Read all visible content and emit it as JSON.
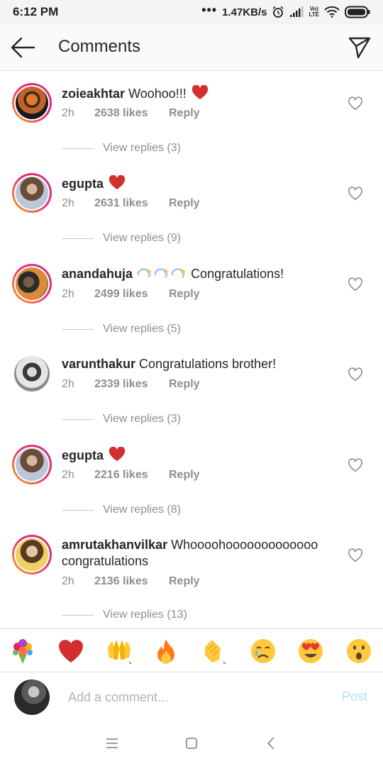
{
  "status_bar": {
    "time": "6:12 PM",
    "network_speed": "1.47KB/s",
    "volte_top": "Vo)",
    "volte_bottom": "LTE"
  },
  "header": {
    "title": "Comments",
    "back_icon": "arrow-left-icon",
    "share_icon": "paper-plane-icon"
  },
  "comments": [
    {
      "user": "zoieakhtar",
      "text": "Woohoo!!!",
      "emoji": "red-heart",
      "time": "2h",
      "likes": "2638 likes",
      "reply": "Reply",
      "view_replies": "View replies (3)"
    },
    {
      "user": "egupta",
      "text": "",
      "emoji": "red-heart",
      "time": "2h",
      "likes": "2631 likes",
      "reply": "Reply",
      "view_replies": "View replies (9)"
    },
    {
      "user": "anandahuja",
      "text": "Congratulations!",
      "emoji": "dizzy-sparkles-x3",
      "time": "2h",
      "likes": "2499 likes",
      "reply": "Reply",
      "view_replies": "View replies (5)"
    },
    {
      "user": "varunthakur",
      "text": "Congratulations brother!",
      "emoji": "",
      "time": "2h",
      "likes": "2339 likes",
      "reply": "Reply",
      "view_replies": "View replies (3)"
    },
    {
      "user": "egupta",
      "text": "",
      "emoji": "red-heart",
      "time": "2h",
      "likes": "2216 likes",
      "reply": "Reply",
      "view_replies": "View replies (8)"
    },
    {
      "user": "amrutakhanvilkar",
      "text": "Whoooohooooooooooooo congratulations",
      "emoji": "",
      "time": "2h",
      "likes": "2136 likes",
      "reply": "Reply",
      "view_replies": "View replies (13)"
    }
  ],
  "emoji_bar": [
    "bouquet",
    "red-heart",
    "raising-hands",
    "fire",
    "clapping-hands",
    "crying-face",
    "heart-eyes",
    "astonished-face"
  ],
  "composer": {
    "placeholder": "Add a comment...",
    "post_label": "Post"
  },
  "colors": {
    "accent_blue_disabled": "#b2dffc",
    "heart_red": "#ed4956",
    "secondary_text": "#8e8e8e"
  }
}
